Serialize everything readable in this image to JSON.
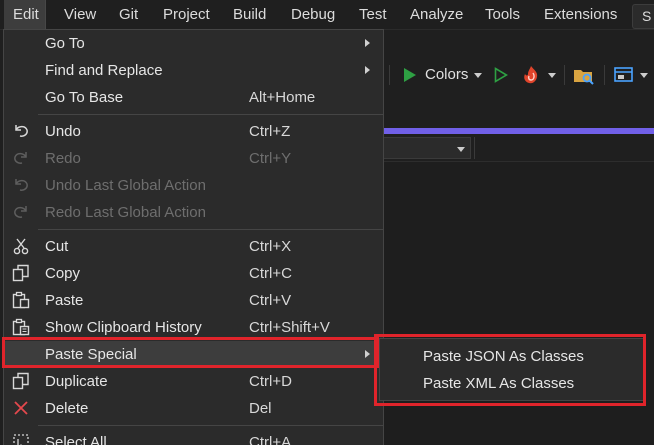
{
  "menubar": {
    "items": [
      {
        "label": "Edit"
      },
      {
        "label": "View"
      },
      {
        "label": "Git"
      },
      {
        "label": "Project"
      },
      {
        "label": "Build"
      },
      {
        "label": "Debug"
      },
      {
        "label": "Test"
      },
      {
        "label": "Analyze"
      },
      {
        "label": "Tools"
      },
      {
        "label": "Extensions"
      }
    ],
    "search_partial": "S"
  },
  "toolbar": {
    "run_config_label": "Colors"
  },
  "edit_menu": {
    "items": [
      {
        "label": "Go To",
        "shortcut": "",
        "submenu": true,
        "enabled": true,
        "icon": "none"
      },
      {
        "label": "Find and Replace",
        "shortcut": "",
        "submenu": true,
        "enabled": true,
        "icon": "none"
      },
      {
        "label": "Go To Base",
        "shortcut": "Alt+Home",
        "submenu": false,
        "enabled": true,
        "icon": "none"
      },
      {
        "label": "Undo",
        "shortcut": "Ctrl+Z",
        "submenu": false,
        "enabled": true,
        "icon": "undo-icon"
      },
      {
        "label": "Redo",
        "shortcut": "Ctrl+Y",
        "submenu": false,
        "enabled": false,
        "icon": "redo-icon"
      },
      {
        "label": "Undo Last Global Action",
        "shortcut": "",
        "submenu": false,
        "enabled": false,
        "icon": "undo-global-icon"
      },
      {
        "label": "Redo Last Global Action",
        "shortcut": "",
        "submenu": false,
        "enabled": false,
        "icon": "redo-global-icon"
      },
      {
        "label": "Cut",
        "shortcut": "Ctrl+X",
        "submenu": false,
        "enabled": true,
        "icon": "cut-icon"
      },
      {
        "label": "Copy",
        "shortcut": "Ctrl+C",
        "submenu": false,
        "enabled": true,
        "icon": "copy-icon"
      },
      {
        "label": "Paste",
        "shortcut": "Ctrl+V",
        "submenu": false,
        "enabled": true,
        "icon": "paste-icon"
      },
      {
        "label": "Show Clipboard History",
        "shortcut": "Ctrl+Shift+V",
        "submenu": false,
        "enabled": true,
        "icon": "clipboard-history-icon"
      },
      {
        "label": "Paste Special",
        "shortcut": "",
        "submenu": true,
        "enabled": true,
        "icon": "none",
        "highlighted": true
      },
      {
        "label": "Duplicate",
        "shortcut": "Ctrl+D",
        "submenu": false,
        "enabled": true,
        "icon": "duplicate-icon"
      },
      {
        "label": "Delete",
        "shortcut": "Del",
        "submenu": false,
        "enabled": true,
        "icon": "delete-icon"
      },
      {
        "label": "Select All",
        "shortcut": "Ctrl+A",
        "submenu": false,
        "enabled": true,
        "icon": "select-all-icon"
      }
    ]
  },
  "paste_special_submenu": {
    "items": [
      {
        "label": "Paste JSON As Classes"
      },
      {
        "label": "Paste XML As Classes"
      }
    ]
  },
  "colors": {
    "highlight_outline": "#e0242b",
    "accent_tab": "#7160e8",
    "run_green": "#2ea043"
  }
}
